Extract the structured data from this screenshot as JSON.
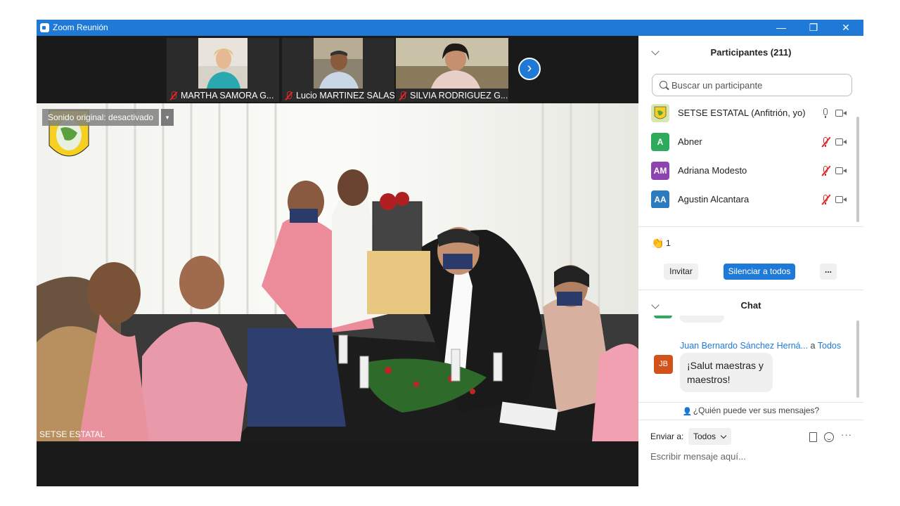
{
  "window": {
    "title": "Zoom Reunión",
    "minimize_glyph": "—",
    "restore_glyph": "❐",
    "close_glyph": "✕"
  },
  "video": {
    "thumbnails": [
      {
        "name": "MARTHA SAMORA G...",
        "muted": true
      },
      {
        "name": "Lucio MARTINEZ SALAS",
        "muted": true
      },
      {
        "name": "SILVIA RODRIGUEZ G...",
        "muted": true
      }
    ],
    "next_page_glyph": "›",
    "original_sound": "Sonido original: desactivado",
    "original_sound_caret": "▾",
    "active_speaker": "SETSE ESTATAL"
  },
  "participants_panel": {
    "header": "Participantes (211)",
    "search_placeholder": "Buscar un participante",
    "participants": [
      {
        "initials": "",
        "name": "SETSE ESTATAL (Anfitrión, yo)",
        "color": "#d8e7b0",
        "mic_muted": false
      },
      {
        "initials": "A",
        "name": "Abner",
        "color": "#2eaa5c",
        "mic_muted": true
      },
      {
        "initials": "AM",
        "name": "Adriana Modesto",
        "color": "#8e44ad",
        "mic_muted": true
      },
      {
        "initials": "AA",
        "name": "Agustin Alcantara",
        "color": "#2d7bbf",
        "mic_muted": true
      }
    ],
    "reactions": [
      {
        "icon": "clapping-hands",
        "glyph": "👏",
        "count": "1"
      }
    ],
    "invite_button": "Invitar",
    "mute_all_button": "Silenciar a todos",
    "more_button": "..."
  },
  "chat_panel": {
    "header": "Chat",
    "messages": [
      {
        "sender": "Juan Bernardo Sánchez Herná...",
        "to_label": "a",
        "target": "Todos",
        "initials": "JB",
        "text": "¡Salut maestras y maestros!"
      }
    ],
    "who_can_see": "¿Quién puede ver sus mensajes?",
    "send_to_label": "Enviar a:",
    "send_to_value": "Todos",
    "input_placeholder": "Escribir mensaje aquí...",
    "more_glyph": "···"
  },
  "colors": {
    "titlebar": "#1e7ad6",
    "accent": "#1e7ad6",
    "muted_red": "#e02828"
  }
}
